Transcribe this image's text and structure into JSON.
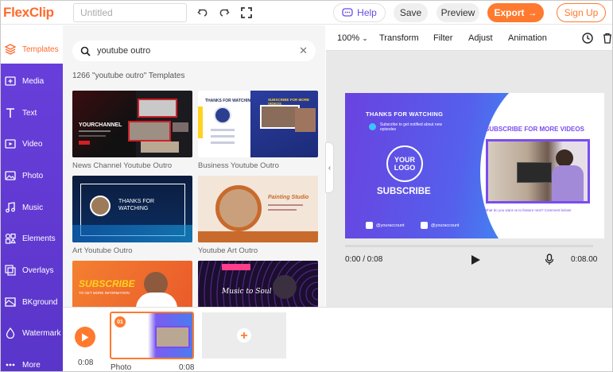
{
  "app": {
    "logo_text": "FlexClip",
    "logo_first": "F",
    "logo_rest": "lexClip"
  },
  "header": {
    "title_placeholder": "Untitled",
    "help_label": "Help",
    "save_label": "Save",
    "preview_label": "Preview",
    "export_label": "Export",
    "signup_label": "Sign Up"
  },
  "rail": {
    "items": [
      {
        "label": "Templates",
        "icon": "templates-icon"
      },
      {
        "label": "Media",
        "icon": "media-icon"
      },
      {
        "label": "Text",
        "icon": "text-icon"
      },
      {
        "label": "Video",
        "icon": "video-icon"
      },
      {
        "label": "Photo",
        "icon": "photo-icon"
      },
      {
        "label": "Music",
        "icon": "music-icon"
      },
      {
        "label": "Elements",
        "icon": "elements-icon"
      },
      {
        "label": "Overlays",
        "icon": "overlays-icon"
      },
      {
        "label": "BKground",
        "icon": "background-icon"
      },
      {
        "label": "Watermark",
        "icon": "watermark-icon"
      },
      {
        "label": "More",
        "icon": "more-icon"
      }
    ]
  },
  "templates": {
    "search_value": "youtube outro",
    "count_label": "1266 \"youtube outro\" Templates",
    "items": [
      {
        "label": "News Channel Youtube Outro"
      },
      {
        "label": "Business Youtube Outro"
      },
      {
        "label": "Art Youtube Outro"
      },
      {
        "label": "Youtube Art Outro"
      },
      {
        "label": ""
      },
      {
        "label": ""
      }
    ],
    "thumb_text": {
      "t1_channel": "YOURCHANNEL",
      "t2_thanks": "THANKS FOR WATCHING",
      "t2_subscribe": "SUBSCRIBE FOR MORE VIDEOS",
      "t3_thanks": "THANKS FOR WATCHING",
      "t4_title": "Painting Studio",
      "t5_subscribe": "SUBSCRIBE",
      "t5_sub": "TO GET MORE INFORMATION",
      "t6_script": "Music to Soul"
    }
  },
  "canvas_toolbar": {
    "zoom": "100%",
    "transform": "Transform",
    "filter": "Filter",
    "adjust": "Adjust",
    "animation": "Animation"
  },
  "preview": {
    "thanks": "THANKS FOR WATCHING",
    "notify": "Subscribe to get notified about new episodes",
    "logo_line1": "YOUR",
    "logo_line2": "LOGO",
    "subscribe": "SUBSCRIBE",
    "twitter": "@youraccount",
    "facebook": "@youraccount",
    "more_videos": "SUBSCRIBE FOR MORE VIDEOS",
    "comment": "What do you want us to feature next? Comment below!"
  },
  "player": {
    "time_current": "0:00 / 0:08",
    "time_total": "0:08.00"
  },
  "timeline": {
    "duration": "0:08",
    "clip_number": "01",
    "clip_type": "Photo",
    "clip_duration": "0:08"
  },
  "colors": {
    "accent": "#ff7a2f",
    "rail": "#5f38d4",
    "purple": "#6a4ce8"
  }
}
